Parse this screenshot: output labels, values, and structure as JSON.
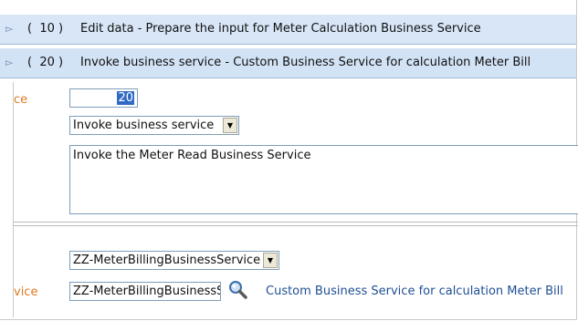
{
  "steps": [
    {
      "seq": "10",
      "desc": "Edit data - Prepare the input for Meter Calculation Business Service"
    },
    {
      "seq": "20",
      "desc": "Invoke business service - Custom Business Service for calculation Meter Bill"
    }
  ],
  "form": {
    "seq_label_fragment": "ce",
    "seq_value": "20",
    "step_type_value": "Invoke business service",
    "description_text": "Invoke the Meter Read Business Service",
    "bs_select_value": "ZZ-MeterBillingBusinessService",
    "bs_label_fragment": "vice",
    "bs_input_value": "ZZ-MeterBillingBusinessSe",
    "bs_description": "Custom Business Service for calculation Meter Bill"
  },
  "icons": {
    "expander": "expand-arrow-icon",
    "search": "search-icon",
    "dropdown": "chevron-down-icon"
  },
  "colors": {
    "row_bg": "#d8e6f7",
    "label_orange": "#e07b22",
    "link_blue": "#1f4f94",
    "selection": "#316ac5"
  }
}
